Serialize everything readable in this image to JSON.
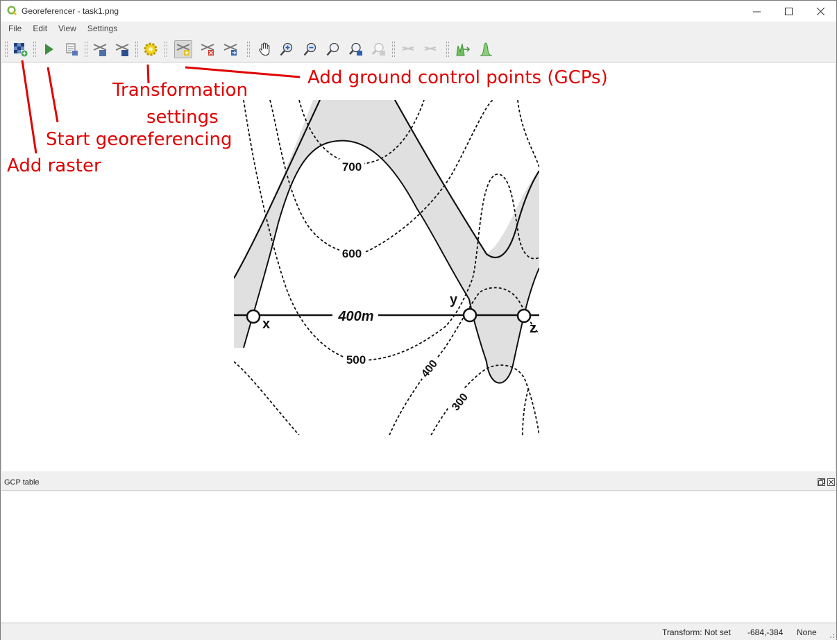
{
  "window": {
    "title": "Georeferencer - task1.png"
  },
  "menu": {
    "items": [
      "File",
      "Edit",
      "View",
      "Settings"
    ]
  },
  "toolbar": {
    "buttons": [
      {
        "name": "add-raster-icon"
      },
      {
        "name": "start-georeferencing-icon"
      },
      {
        "name": "generate-gdal-script-icon"
      },
      {
        "name": "load-gcp-points-icon"
      },
      {
        "name": "save-gcp-points-icon"
      },
      {
        "name": "transformation-settings-icon"
      },
      {
        "name": "add-point-icon"
      },
      {
        "name": "delete-point-icon"
      },
      {
        "name": "move-gcp-point-icon"
      },
      {
        "name": "pan-icon"
      },
      {
        "name": "zoom-in-icon"
      },
      {
        "name": "zoom-out-icon"
      },
      {
        "name": "zoom-to-layer-icon"
      },
      {
        "name": "zoom-last-icon"
      },
      {
        "name": "zoom-next-icon"
      },
      {
        "name": "link-georeferencer-to-qgis-icon"
      },
      {
        "name": "link-qgis-to-georeferencer-icon"
      },
      {
        "name": "full-histogram-stretch-icon"
      },
      {
        "name": "local-histogram-stretch-icon"
      }
    ]
  },
  "map": {
    "contour_labels": [
      "700",
      "600",
      "400m",
      "500",
      "400",
      "300"
    ],
    "point_labels": [
      "x",
      "y",
      "z"
    ]
  },
  "annotations": {
    "add_raster": "Add raster",
    "start_georeferencing": "Start georeferencing",
    "transformation_settings_1": "Transformation",
    "transformation_settings_2": "settings",
    "add_gcps": "Add ground control points (GCPs)"
  },
  "dock": {
    "title": "GCP table"
  },
  "status": {
    "transform": "Transform: Not set",
    "coords": "-684,-384",
    "crs": "None"
  },
  "colors": {
    "annotation": "#e00000",
    "sandstone": "#e0e0e0"
  }
}
